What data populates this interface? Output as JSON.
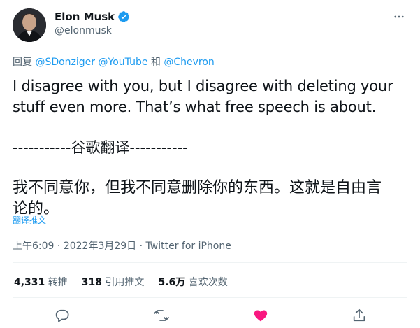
{
  "author": {
    "display_name": "Elon Musk",
    "handle": "@elonmusk",
    "verified": true
  },
  "reply_to": {
    "prefix": "回复",
    "users": [
      "@SDonziger",
      "@YouTube"
    ],
    "conjunction": "和",
    "last_user": "@Chevron"
  },
  "tweet": {
    "text_line1": "I disagree with you, but I disagree with deleting your",
    "text_line2": "stuff even more. That’s what free speech is about.",
    "separator": "-----------谷歌翻译-----------",
    "translation_line1": "我不同意你，但我不同意删除你的东西。这就是自由言",
    "translation_line2": "论的。",
    "translate_link": "翻译推文"
  },
  "meta": {
    "time": "上午6:09",
    "dot": "·",
    "date": "2022年3月29日",
    "source": "Twitter for iPhone"
  },
  "stats": {
    "retweets": "4,331",
    "retweets_label": "转推",
    "quotes": "318",
    "quotes_label": "引用推文",
    "likes": "5.6万",
    "likes_label": "喜欢次数"
  },
  "colors": {
    "link": "#1d9bf0",
    "secondary": "#536471",
    "like": "#f91880"
  },
  "icons": [
    "verified-badge-icon",
    "more-icon",
    "reply-icon",
    "retweet-icon",
    "like-icon",
    "share-icon"
  ]
}
